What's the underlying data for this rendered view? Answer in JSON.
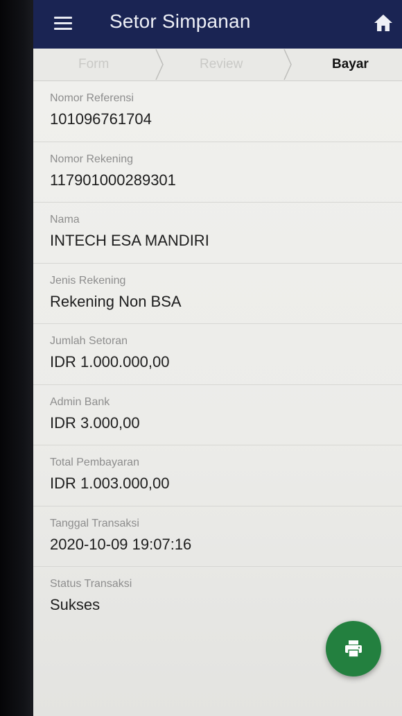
{
  "header": {
    "title": "Setor Simpanan",
    "menu_icon": "hamburger-menu-icon",
    "home_icon": "home-icon",
    "color": "#1a2453"
  },
  "stepper": {
    "steps": [
      {
        "label": "Form",
        "state": "done"
      },
      {
        "label": "Review",
        "state": "done"
      },
      {
        "label": "Bayar",
        "state": "active"
      }
    ]
  },
  "fields": [
    {
      "label": "Nomor Referensi",
      "value": "101096761704"
    },
    {
      "label": "Nomor Rekening",
      "value": "117901000289301"
    },
    {
      "label": "Nama",
      "value": "INTECH ESA MANDIRI"
    },
    {
      "label": "Jenis Rekening",
      "value": "Rekening Non BSA"
    },
    {
      "label": "Jumlah Setoran",
      "value": "IDR 1.000.000,00"
    },
    {
      "label": "Admin Bank",
      "value": "IDR 3.000,00"
    },
    {
      "label": "Total Pembayaran",
      "value": "IDR 1.003.000,00"
    },
    {
      "label": "Tanggal Transaksi",
      "value": "2020-10-09 19:07:16"
    },
    {
      "label": "Status Transaksi",
      "value": "Sukses"
    }
  ],
  "fab": {
    "icon": "print-icon",
    "color": "#23803f"
  }
}
